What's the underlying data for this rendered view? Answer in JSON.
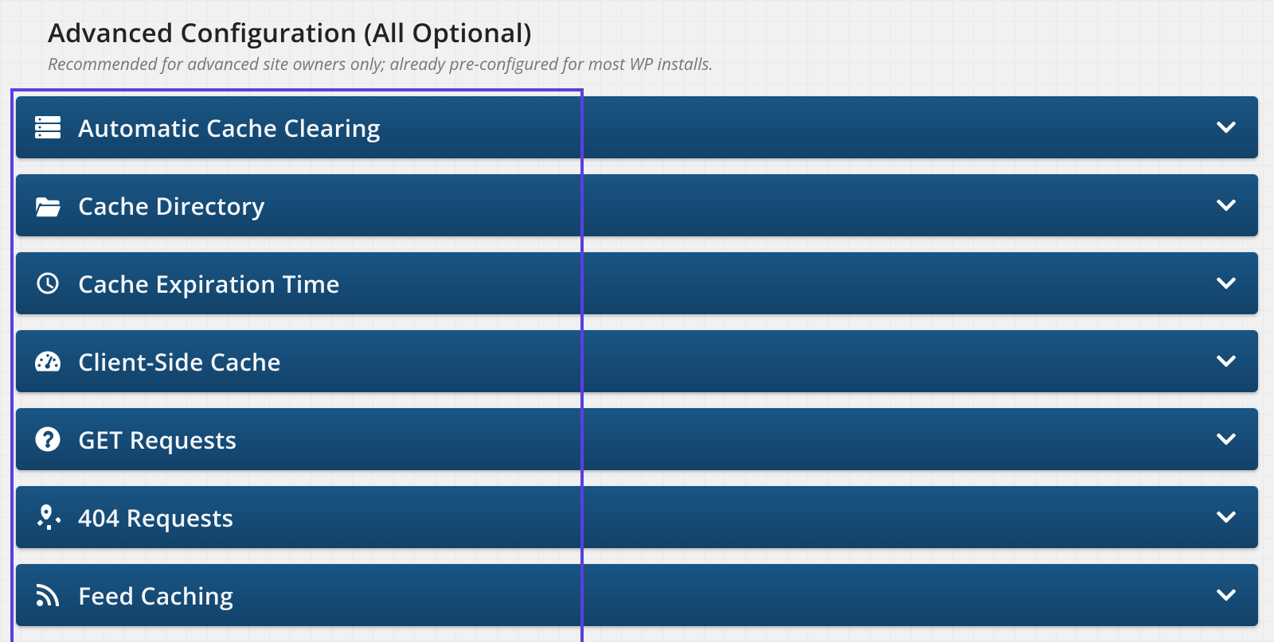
{
  "heading": {
    "title": "Advanced Configuration (All Optional)",
    "subtitle": "Recommended for advanced site owners only; already pre-configured for most WP installs."
  },
  "panels": [
    {
      "label": "Automatic Cache Clearing",
      "icon": "server"
    },
    {
      "label": "Cache Directory",
      "icon": "folder-open"
    },
    {
      "label": "Cache Expiration Time",
      "icon": "clock"
    },
    {
      "label": "Client-Side Cache",
      "icon": "gauge"
    },
    {
      "label": "GET Requests",
      "icon": "question-circle"
    },
    {
      "label": "404 Requests",
      "icon": "unlink"
    },
    {
      "label": "Feed Caching",
      "icon": "rss"
    }
  ],
  "colors": {
    "panel_bg": "#14486f",
    "highlight": "#5a3fe0"
  }
}
